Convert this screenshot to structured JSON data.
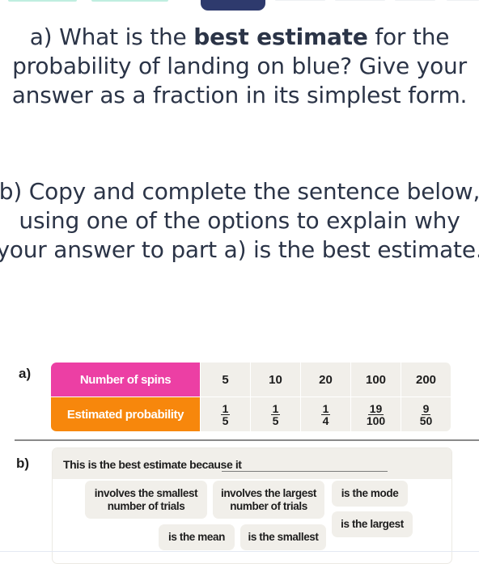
{
  "progress": {
    "segments": [
      "done",
      "done",
      "current",
      "todo",
      "todo",
      "todo",
      "todo"
    ]
  },
  "question_a": {
    "prefix": "a) What is the ",
    "bold": "best estimate",
    "suffix": " for the probability of landing on blue? Give your answer as a fraction in its simplest form."
  },
  "question_b": {
    "text": "b) Copy and complete the sentence below, using one of the options to explain why your answer to part a) is the best estimate."
  },
  "figure": {
    "part_a_label": "a)",
    "part_b_label": "b)",
    "table": {
      "row1_header": "Number of spins",
      "row2_header": "Estimated probability",
      "spins": [
        "5",
        "10",
        "20",
        "100",
        "200"
      ],
      "probabilities": [
        {
          "num": "1",
          "den": "5"
        },
        {
          "num": "1",
          "den": "5"
        },
        {
          "num": "1",
          "den": "4"
        },
        {
          "num": "19",
          "den": "100"
        },
        {
          "num": "9",
          "den": "50"
        }
      ],
      "colors": {
        "row1": "#ec3fa4",
        "row2": "#f7870c"
      }
    },
    "sentence": "This is the best estimate because it",
    "options": [
      "involves the smallest number of trials",
      "involves the largest number of trials",
      "is the mode",
      "is the mean",
      "is the smallest",
      "is the largest"
    ]
  }
}
